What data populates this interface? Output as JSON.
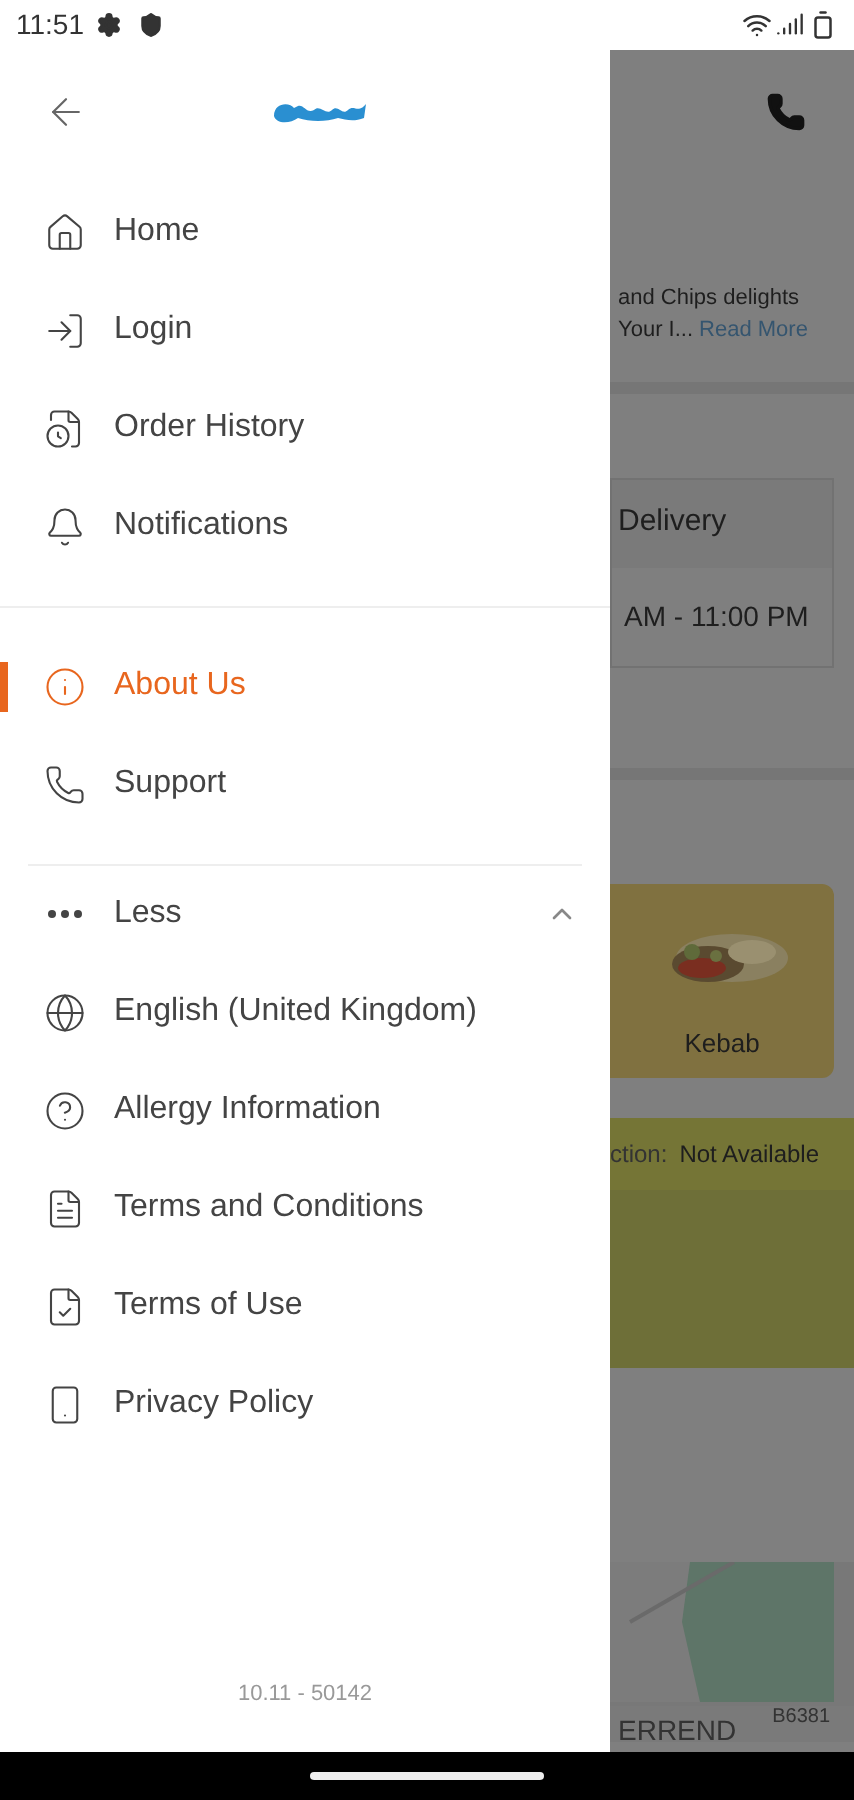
{
  "status_bar": {
    "time": "11:51"
  },
  "drawer": {
    "groups": [
      {
        "items": [
          {
            "label": "Home",
            "selected": false
          },
          {
            "label": "Login",
            "selected": false
          },
          {
            "label": "Order History",
            "selected": false
          },
          {
            "label": "Notifications",
            "selected": false
          }
        ]
      },
      {
        "items": [
          {
            "label": "About Us",
            "selected": true
          },
          {
            "label": "Support",
            "selected": false
          }
        ]
      }
    ],
    "more_toggle": {
      "label": "Less",
      "expanded": true
    },
    "more_items": [
      {
        "label": "English (United Kingdom)",
        "selected": false
      },
      {
        "label": "Allergy Information",
        "selected": false
      },
      {
        "label": "Terms and Conditions",
        "selected": false
      },
      {
        "label": "Terms of Use",
        "selected": false
      },
      {
        "label": "Privacy Policy",
        "selected": false
      }
    ],
    "version": "10.11 - 50142"
  },
  "background": {
    "description_lines": [
      "and Chips delights",
      "Your I..."
    ],
    "read_more": "Read More",
    "delivery_label": "Delivery",
    "hours": "AM - 11:00 PM",
    "category": "Kebab",
    "collection_label": "ction:",
    "collection_value": "Not Available",
    "map_labels": [
      "ERREND",
      "B6381"
    ]
  }
}
